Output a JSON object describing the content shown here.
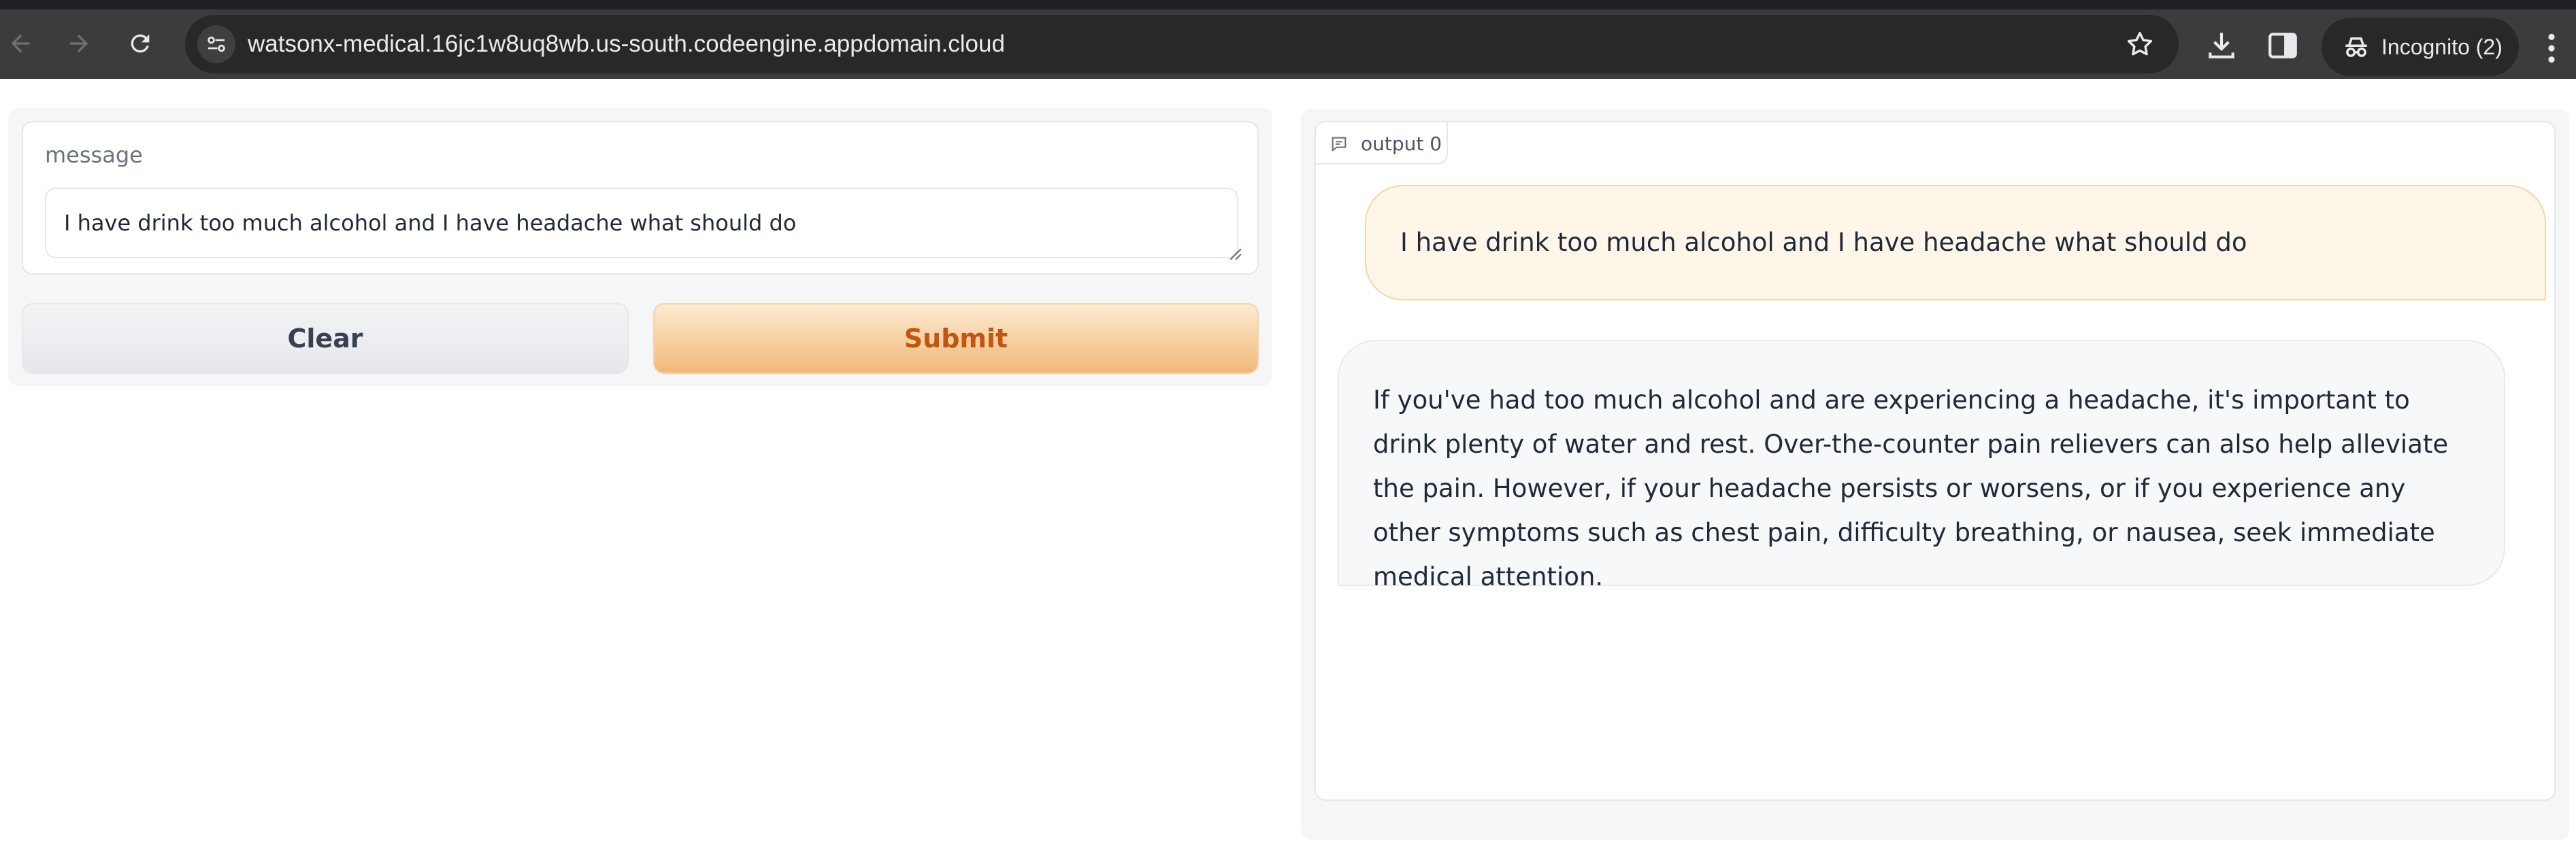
{
  "browser": {
    "url": "watsonx-medical.16jc1w8uq8wb.us-south.codeengine.appdomain.cloud",
    "incognito_label": "Incognito (2)",
    "icons": [
      "back-arrow-icon",
      "forward-arrow-icon",
      "reload-icon",
      "site-info-icon",
      "star-icon",
      "download-icon",
      "side-panel-icon",
      "incognito-icon",
      "kebab-menu-icon"
    ]
  },
  "form": {
    "message_label": "message",
    "message_value": "I have drink too much alcohol and I have headache what should do",
    "clear_label": "Clear",
    "submit_label": "Submit"
  },
  "output": {
    "tab_label": "output 0",
    "user_message": "I have drink too much alcohol and I have headache what should do",
    "bot_message": "If you've had too much alcohol and are experiencing a headache, it's important to drink plenty of water and rest. Over-the-counter pain relievers can also help alleviate the pain. However, if your headache persists or worsens, or if you experience any other symptoms such as chest pain, difficulty breathing, or nausea, seek immediate medical attention."
  },
  "colors": {
    "accent": "#c2560f",
    "submit_bg": "#f0b878",
    "user_bubble_bg": "#fef6e9",
    "chrome_bg": "#3c3c3c"
  }
}
